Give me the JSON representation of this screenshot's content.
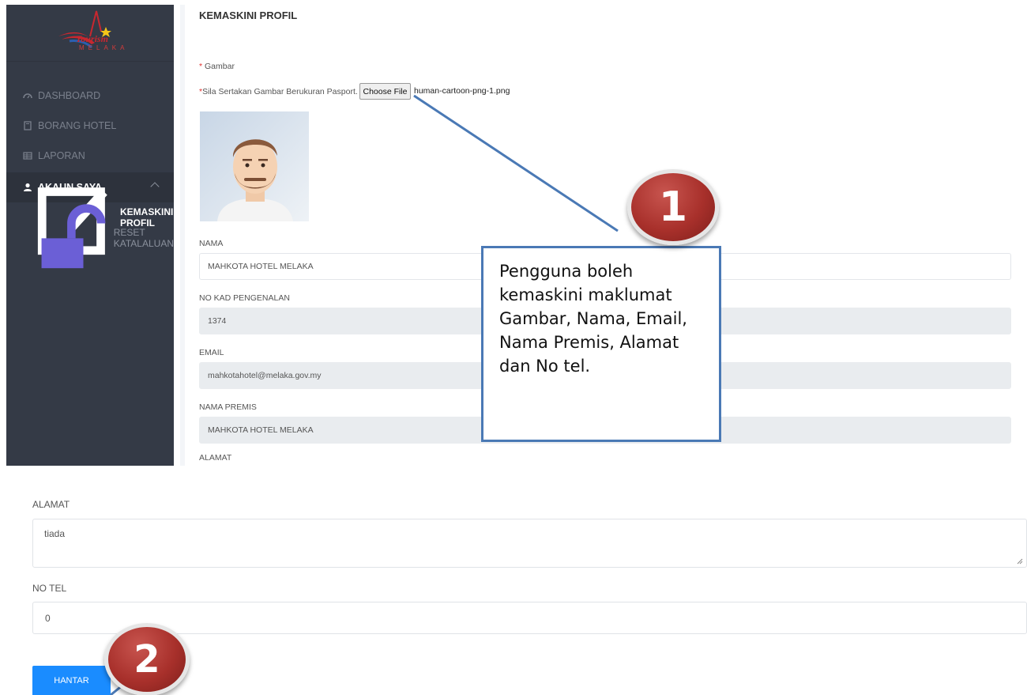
{
  "brand": {
    "wordmark": "Tourism",
    "sub": "MELAKA",
    "colors": {
      "sidebar_bg": "#343a46",
      "accent": "#1a8cff",
      "callout_border": "#4a79b5",
      "badge": "#a8302b"
    }
  },
  "sidebar": {
    "items": [
      {
        "label": "DASHBOARD",
        "icon": "dashboard-icon"
      },
      {
        "label": "BORANG HOTEL",
        "icon": "file-icon"
      },
      {
        "label": "LAPORAN",
        "icon": "table-icon"
      },
      {
        "label": "AKAUN SAYA",
        "icon": "user-icon"
      }
    ],
    "subitems": [
      {
        "label": "KEMASKINI PROFIL",
        "icon": "edit-icon"
      },
      {
        "label": "RESET KATALALUAN",
        "icon": "unlock-icon"
      }
    ]
  },
  "page": {
    "title": "KEMASKINI PROFIL",
    "gambar_label": "Gambar",
    "gambar_hint": "Sila Sertakan Gambar Berukuran Pasport.",
    "file_button": "Choose File",
    "file_name": "human-cartoon-png-1.png",
    "required_mark": "*"
  },
  "form": {
    "nama": {
      "label": "NAMA",
      "value": "MAHKOTA HOTEL MELAKA"
    },
    "ic": {
      "label": "NO KAD PENGENALAN",
      "value": "1374"
    },
    "email": {
      "label": "EMAIL",
      "value": "mahkotahotel@melaka.gov.my"
    },
    "premis": {
      "label": "NAMA PREMIS",
      "value": "MAHKOTA HOTEL MELAKA"
    },
    "alamat_top_label": "ALAMAT",
    "alamat": {
      "label": "ALAMAT",
      "value": "tiada"
    },
    "tel": {
      "label": "NO TEL",
      "value": "0"
    },
    "submit": "HANTAR"
  },
  "callouts": {
    "badge1": "1",
    "badge2": "2",
    "note": "Pengguna boleh kemaskini maklumat Gambar, Nama, Email, Nama Premis, Alamat dan No tel."
  }
}
